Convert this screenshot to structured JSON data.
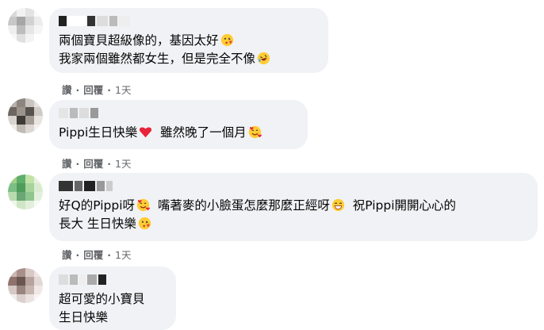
{
  "comments": [
    {
      "lines": [
        "兩個寶貝超級像的，基因太好",
        "我家兩個雖然都女生，但是完全不像"
      ],
      "emojis": [
        "kissing-face-with-heart-icon",
        "rolling-laughing-face-icon"
      ],
      "actions": {
        "like": "讚",
        "reply": "回覆",
        "time": "1天"
      }
    },
    {
      "lines": [
        "Pippi生日快樂",
        "雖然晚了一個月"
      ],
      "emojis": [
        "red-heart-icon",
        "smiling-face-with-hearts-icon"
      ],
      "actions": {
        "like": "讚",
        "reply": "回覆",
        "time": "1天"
      }
    },
    {
      "lines": [
        "好Q的Pippi呀",
        "嘴著麥的小臉蛋怎麼那麼正經呀",
        "祝Pippi開開心心的",
        "長大 生日快樂"
      ],
      "emojis": [
        "smiling-face-with-hearts-icon",
        "grinning-face-icon",
        "kissing-face-with-heart-icon"
      ],
      "actions": {
        "like": "讚",
        "reply": "回覆",
        "time": "1天"
      }
    },
    {
      "lines": [
        "超可愛的小寶貝",
        "生日快樂"
      ],
      "actions": {}
    }
  ],
  "separator": "·"
}
